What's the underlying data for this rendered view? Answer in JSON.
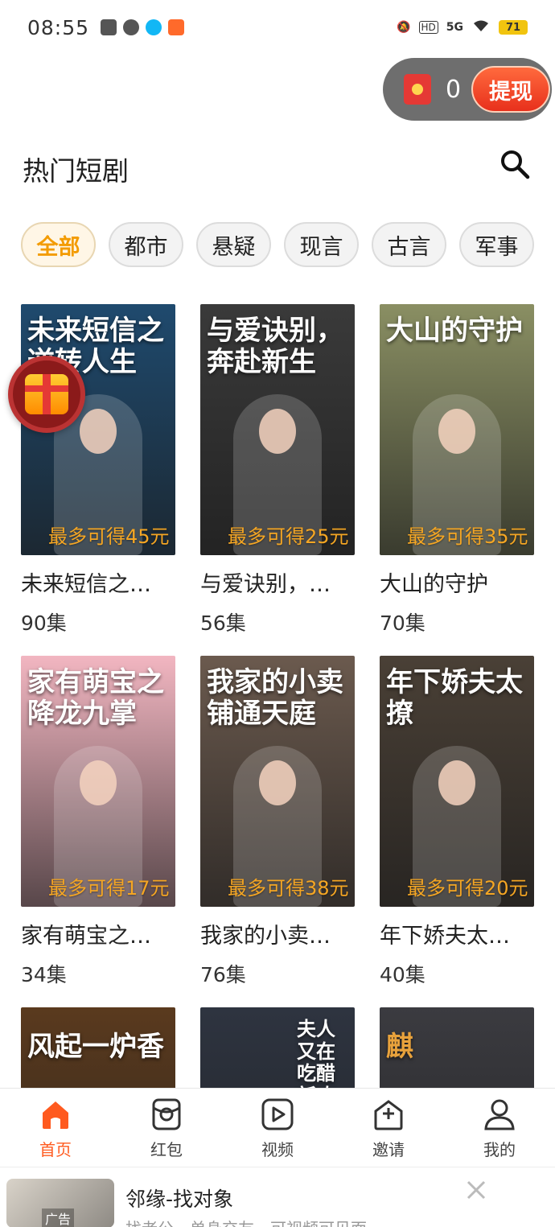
{
  "status_bar": {
    "time": "08:55",
    "battery": "71",
    "network": "5G",
    "hd": "HD"
  },
  "wallet": {
    "coins": "0",
    "withdraw_label": "提现"
  },
  "header": {
    "title": "热门短剧"
  },
  "categories": [
    {
      "label": "全部",
      "active": true
    },
    {
      "label": "都市",
      "active": false
    },
    {
      "label": "悬疑",
      "active": false
    },
    {
      "label": "现言",
      "active": false
    },
    {
      "label": "古言",
      "active": false
    },
    {
      "label": "军事",
      "active": false
    }
  ],
  "dramas": [
    {
      "poster_title": "未来短信之逆转人生",
      "name": "未来短信之…",
      "episodes": "90集",
      "reward": "最多可得45元",
      "bg": "#1f4a6e"
    },
    {
      "poster_title": "与爱诀别，奔赴新生",
      "name": "与爱诀别，…",
      "episodes": "56集",
      "reward": "最多可得25元",
      "bg": "#3a3a3a"
    },
    {
      "poster_title": "大山的守护",
      "name": "大山的守护",
      "episodes": "70集",
      "reward": "最多可得35元",
      "bg": "#8a8f63"
    },
    {
      "poster_title": "家有萌宝之降龙九掌",
      "name": "家有萌宝之…",
      "episodes": "34集",
      "reward": "最多可得17元",
      "bg": "#f2b6c1"
    },
    {
      "poster_title": "我家的小卖铺通天庭",
      "name": "我家的小卖…",
      "episodes": "76集",
      "reward": "最多可得38元",
      "bg": "#6b5a4e"
    },
    {
      "poster_title": "年下娇夫太撩",
      "name": "年下娇夫太…",
      "episodes": "40集",
      "reward": "最多可得20元",
      "bg": "#4a4036"
    },
    {
      "poster_title": "风起一炉香",
      "name": "",
      "episodes": "",
      "reward": "",
      "bg": "#5a3a1e"
    },
    {
      "poster_title": "夫人又在吃醋新欢",
      "name": "",
      "episodes": "",
      "reward": "",
      "bg": "#2e3440"
    },
    {
      "poster_title": "麒",
      "name": "",
      "episodes": "",
      "reward": "",
      "bg": "#3b3b40"
    }
  ],
  "bottom_nav": [
    {
      "label": "首页",
      "icon": "home-icon",
      "active": true
    },
    {
      "label": "红包",
      "icon": "red-packet-icon",
      "active": false
    },
    {
      "label": "视频",
      "icon": "video-icon",
      "active": false
    },
    {
      "label": "邀请",
      "icon": "invite-icon",
      "active": false
    },
    {
      "label": "我的",
      "icon": "profile-icon",
      "active": false
    }
  ],
  "ad": {
    "title": "邻缘-找对象",
    "description": "找老公，单身交友，可视频可见面",
    "tag": "广告"
  }
}
